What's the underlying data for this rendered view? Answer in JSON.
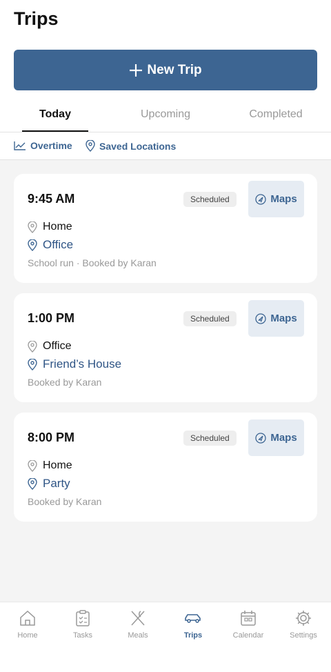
{
  "header": {
    "title": "Trips",
    "new_trip_label": "New Trip"
  },
  "tabs": [
    {
      "label": "Today",
      "active": true
    },
    {
      "label": "Upcoming",
      "active": false
    },
    {
      "label": "Completed",
      "active": false
    }
  ],
  "links": {
    "overtime": "Overtime",
    "saved_locations": "Saved Locations"
  },
  "trips": [
    {
      "time": "9:45 AM",
      "status": "Scheduled",
      "maps_label": "Maps",
      "from": "Home",
      "to": "Office",
      "note": "School run · Booked by Karan"
    },
    {
      "time": "1:00 PM",
      "status": "Scheduled",
      "maps_label": "Maps",
      "from": "Office",
      "to": "Friend’s House",
      "note": "Booked by Karan"
    },
    {
      "time": "8:00 PM",
      "status": "Scheduled",
      "maps_label": "Maps",
      "from": "Home",
      "to": "Party",
      "note": "Booked by Karan"
    }
  ],
  "nav": [
    {
      "label": "Home",
      "icon": "home-icon",
      "active": false
    },
    {
      "label": "Tasks",
      "icon": "clipboard-icon",
      "active": false
    },
    {
      "label": "Meals",
      "icon": "utensils-icon",
      "active": false
    },
    {
      "label": "Trips",
      "icon": "car-icon",
      "active": true
    },
    {
      "label": "Calendar",
      "icon": "calendar-icon",
      "active": false
    },
    {
      "label": "Settings",
      "icon": "gear-icon",
      "active": false
    }
  ],
  "colors": {
    "accent": "#3d6592",
    "background": "#f4f4f4"
  }
}
